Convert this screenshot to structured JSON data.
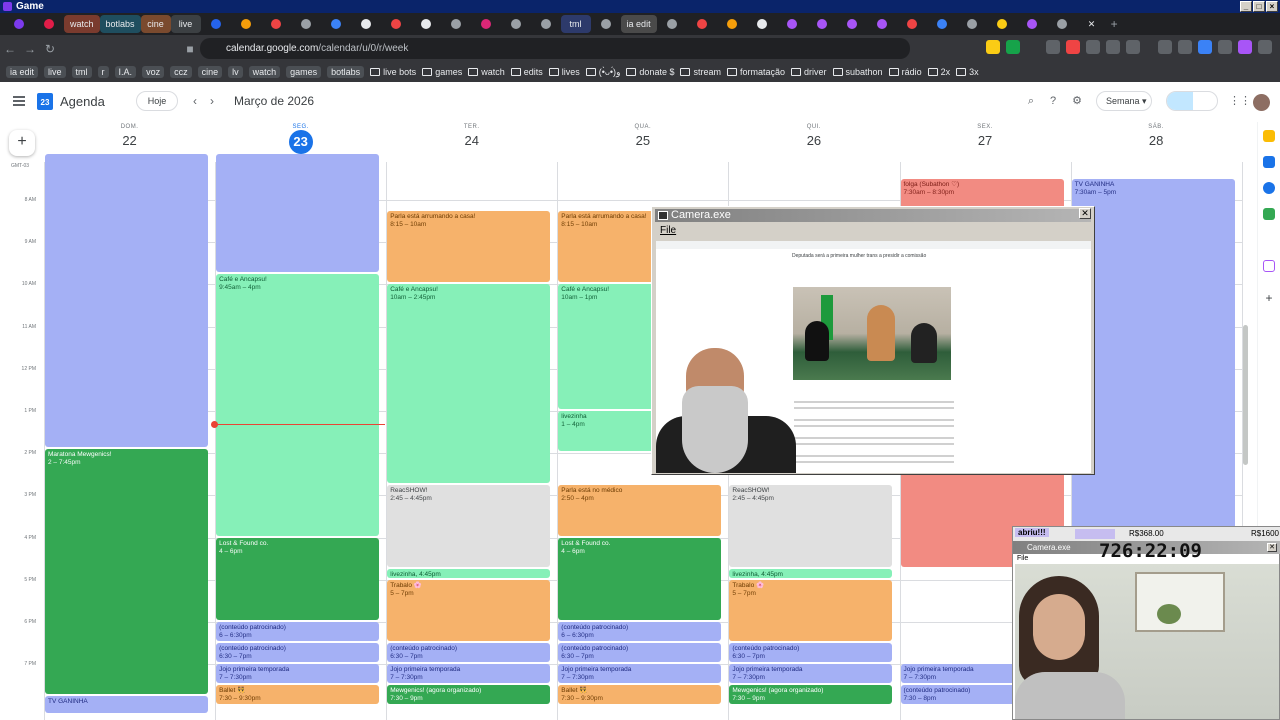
{
  "os": {
    "title": "Game"
  },
  "tabs": [
    {
      "kind": "icon",
      "color": "#7c3aed"
    },
    {
      "kind": "icon",
      "color": "#e11d48"
    },
    {
      "kind": "text",
      "label": "watch",
      "color": "#7a3b2e"
    },
    {
      "kind": "text",
      "label": "botlabs",
      "color": "#1f4e5f"
    },
    {
      "kind": "text",
      "label": "cine",
      "color": "#7a4a2e"
    },
    {
      "kind": "text",
      "label": "live",
      "color": "#3c4043"
    },
    {
      "kind": "icon",
      "color": "#2563eb"
    },
    {
      "kind": "icon",
      "color": "#f59e0b"
    },
    {
      "kind": "icon",
      "color": "#ef4444"
    },
    {
      "kind": "icon",
      "color": "#9aa0a6"
    },
    {
      "kind": "icon",
      "color": "#3b82f6"
    },
    {
      "kind": "icon",
      "color": "#e8eaed"
    },
    {
      "kind": "icon",
      "color": "#ef4444"
    },
    {
      "kind": "icon",
      "color": "#e8eaed"
    },
    {
      "kind": "icon",
      "color": "#9aa0a6"
    },
    {
      "kind": "icon",
      "color": "#db2777"
    },
    {
      "kind": "icon",
      "color": "#9aa0a6"
    },
    {
      "kind": "icon",
      "color": "#9aa0a6"
    },
    {
      "kind": "text",
      "label": "tml",
      "color": "#2d3a6b"
    },
    {
      "kind": "icon",
      "color": "#9aa0a6"
    },
    {
      "kind": "text",
      "label": "ia edit",
      "color": "#4a4a4a"
    },
    {
      "kind": "icon",
      "color": "#9aa0a6"
    },
    {
      "kind": "icon",
      "color": "#ef4444"
    },
    {
      "kind": "icon",
      "color": "#f59e0b"
    },
    {
      "kind": "icon",
      "color": "#e8eaed"
    },
    {
      "kind": "icon",
      "color": "#a855f7"
    },
    {
      "kind": "icon",
      "color": "#a855f7"
    },
    {
      "kind": "icon",
      "color": "#a855f7"
    },
    {
      "kind": "icon",
      "color": "#a855f7"
    },
    {
      "kind": "icon",
      "color": "#ef4444"
    },
    {
      "kind": "icon",
      "color": "#3b82f6"
    },
    {
      "kind": "icon",
      "color": "#9aa0a6"
    },
    {
      "kind": "icon",
      "color": "#facc15"
    },
    {
      "kind": "icon",
      "color": "#a855f7"
    },
    {
      "kind": "icon",
      "color": "#9aa0a6"
    },
    {
      "kind": "close",
      "label": "✕"
    }
  ],
  "address": {
    "host": "calendar.google.com",
    "path": "/calendar/u/0/r/week"
  },
  "bookmarks": [
    {
      "type": "chip",
      "label": "ia edit"
    },
    {
      "type": "chip",
      "label": "live"
    },
    {
      "type": "chip",
      "label": "tml"
    },
    {
      "type": "chip",
      "label": "r"
    },
    {
      "type": "chip",
      "label": "I.A."
    },
    {
      "type": "chip",
      "label": "voz"
    },
    {
      "type": "chip",
      "label": "ccz"
    },
    {
      "type": "chip",
      "label": "cine"
    },
    {
      "type": "chip",
      "label": "lv"
    },
    {
      "type": "chip",
      "label": "watch"
    },
    {
      "type": "chip",
      "label": "games"
    },
    {
      "type": "chip",
      "label": "botlabs"
    },
    {
      "type": "folder",
      "label": "live bots"
    },
    {
      "type": "folder",
      "label": "games"
    },
    {
      "type": "folder",
      "label": "watch"
    },
    {
      "type": "folder",
      "label": "edits"
    },
    {
      "type": "folder",
      "label": "lives"
    },
    {
      "type": "folder",
      "label": "(•̀ᴗ•́)و"
    },
    {
      "type": "folder",
      "label": "donate $"
    },
    {
      "type": "folder",
      "label": "stream"
    },
    {
      "type": "folder",
      "label": "formatação"
    },
    {
      "type": "folder",
      "label": "driver"
    },
    {
      "type": "folder",
      "label": "subathon"
    },
    {
      "type": "folder",
      "label": "rádio"
    },
    {
      "type": "folder",
      "label": "2x"
    },
    {
      "type": "folder",
      "label": "3x"
    }
  ],
  "calendar": {
    "app_name": "Agenda",
    "logo_day": "23",
    "today_label": "Hoje",
    "month": "Março de 2026",
    "view_label": "Semana",
    "timezone": "GMT-03",
    "days": [
      {
        "name": "DOM.",
        "num": "22",
        "today": false
      },
      {
        "name": "SEG.",
        "num": "23",
        "today": true
      },
      {
        "name": "TER.",
        "num": "24",
        "today": false
      },
      {
        "name": "QUA.",
        "num": "25",
        "today": false
      },
      {
        "name": "QUI.",
        "num": "26",
        "today": false
      },
      {
        "name": "SEX.",
        "num": "27",
        "today": false
      },
      {
        "name": "SÁB.",
        "num": "28",
        "today": false
      }
    ],
    "hours": [
      "8 AM",
      "9 AM",
      "10 AM",
      "11 AM",
      "12 PM",
      "1 PM",
      "2 PM",
      "3 PM",
      "4 PM",
      "5 PM",
      "6 PM",
      "7 PM"
    ],
    "events": [
      {
        "day": 0,
        "start": 6.9,
        "end": 13.9,
        "title": "",
        "time": "",
        "color": "blue"
      },
      {
        "day": 0,
        "start": 13.9,
        "end": 19.75,
        "title": "Maratona Mewgenics!",
        "time": "2 – 7:45pm",
        "color": "green"
      },
      {
        "day": 0,
        "start": 19.75,
        "end": 20.2,
        "title": "TV GANINHA",
        "time": "",
        "color": "blue"
      },
      {
        "day": 1,
        "start": 6.9,
        "end": 9.75,
        "title": "",
        "time": "",
        "color": "blue"
      },
      {
        "day": 1,
        "start": 9.75,
        "end": 16.0,
        "title": "Café e Ancapsu!",
        "time": "9:45am – 4pm",
        "color": "mint"
      },
      {
        "day": 1,
        "start": 16.0,
        "end": 18.0,
        "title": "Lost & Found co.",
        "time": "4 – 6pm",
        "color": "green"
      },
      {
        "day": 1,
        "start": 18.0,
        "end": 18.5,
        "title": "(conteúdo patrocinado)",
        "time": "6 – 6:30pm",
        "color": "blue"
      },
      {
        "day": 1,
        "start": 18.5,
        "end": 19.0,
        "title": "(conteúdo patrocinado)",
        "time": "6:30 – 7pm",
        "color": "blue"
      },
      {
        "day": 1,
        "start": 19.0,
        "end": 19.5,
        "title": "Jojo primeira temporada",
        "time": "7 – 7:30pm",
        "color": "blue"
      },
      {
        "day": 1,
        "start": 19.5,
        "end": 20.0,
        "title": "Ballet 👯",
        "time": "7:30 – 9:30pm",
        "color": "orange"
      },
      {
        "day": 2,
        "start": 8.25,
        "end": 10.0,
        "title": "Parla está arrumando a casa!",
        "time": "8:15 – 10am",
        "color": "orange"
      },
      {
        "day": 2,
        "start": 10.0,
        "end": 14.75,
        "title": "Café e Ancapsu!",
        "time": "10am – 2:45pm",
        "color": "mint"
      },
      {
        "day": 2,
        "start": 14.75,
        "end": 16.75,
        "title": "ReacSHOW!",
        "time": "2:45 – 4:45pm",
        "color": "grey"
      },
      {
        "day": 2,
        "start": 16.75,
        "end": 17.0,
        "title": "livezinha, 4:45pm",
        "time": "",
        "color": "mint"
      },
      {
        "day": 2,
        "start": 17.0,
        "end": 18.5,
        "title": "Trabalo 🌸",
        "time": "5 – 7pm",
        "color": "orange"
      },
      {
        "day": 2,
        "start": 18.5,
        "end": 19.0,
        "title": "(conteúdo patrocinado)",
        "time": "6:30 – 7pm",
        "color": "blue"
      },
      {
        "day": 2,
        "start": 19.0,
        "end": 19.5,
        "title": "Jojo primeira temporada",
        "time": "7 – 7:30pm",
        "color": "blue"
      },
      {
        "day": 2,
        "start": 19.5,
        "end": 20.0,
        "title": "Mewgenics! (agora organizado)",
        "time": "7:30 – 9pm",
        "color": "green"
      },
      {
        "day": 3,
        "start": 8.25,
        "end": 10.0,
        "title": "Parla está arrumando a casa!",
        "time": "8:15 – 10am",
        "color": "orange"
      },
      {
        "day": 3,
        "start": 10.0,
        "end": 13.0,
        "title": "Café e Ancapsu!",
        "time": "10am – 1pm",
        "color": "mint"
      },
      {
        "day": 3,
        "start": 13.0,
        "end": 14.0,
        "title": "livezinha",
        "time": "1 – 4pm",
        "color": "mint"
      },
      {
        "day": 3,
        "start": 14.75,
        "end": 16.0,
        "title": "Parla está no médico",
        "time": "2:50 – 4pm",
        "color": "orange"
      },
      {
        "day": 3,
        "start": 16.0,
        "end": 18.0,
        "title": "Lost & Found co.",
        "time": "4 – 6pm",
        "color": "green"
      },
      {
        "day": 3,
        "start": 18.0,
        "end": 18.5,
        "title": "(conteúdo patrocinado)",
        "time": "6 – 6:30pm",
        "color": "blue"
      },
      {
        "day": 3,
        "start": 18.5,
        "end": 19.0,
        "title": "(conteúdo patrocinado)",
        "time": "6:30 – 7pm",
        "color": "blue"
      },
      {
        "day": 3,
        "start": 19.0,
        "end": 19.5,
        "title": "Jojo primeira temporada",
        "time": "7 – 7:30pm",
        "color": "blue"
      },
      {
        "day": 3,
        "start": 19.5,
        "end": 20.0,
        "title": "Ballet 👯",
        "time": "7:30 – 9:30pm",
        "color": "orange"
      },
      {
        "day": 4,
        "start": 14.75,
        "end": 16.75,
        "title": "ReacSHOW!",
        "time": "2:45 – 4:45pm",
        "color": "grey"
      },
      {
        "day": 4,
        "start": 16.75,
        "end": 17.0,
        "title": "livezinha, 4:45pm",
        "time": "",
        "color": "mint"
      },
      {
        "day": 4,
        "start": 17.0,
        "end": 18.5,
        "title": "Trabalo 🌸",
        "time": "5 – 7pm",
        "color": "orange"
      },
      {
        "day": 4,
        "start": 18.5,
        "end": 19.0,
        "title": "(conteúdo patrocinado)",
        "time": "6:30 – 7pm",
        "color": "blue"
      },
      {
        "day": 4,
        "start": 19.0,
        "end": 19.5,
        "title": "Jojo primeira temporada",
        "time": "7 – 7:30pm",
        "color": "blue"
      },
      {
        "day": 4,
        "start": 19.5,
        "end": 20.0,
        "title": "Mewgenics! (agora organizado)",
        "time": "7:30 – 9pm",
        "color": "green"
      },
      {
        "day": 5,
        "start": 7.5,
        "end": 16.75,
        "title": "folga (Subathon ♡)",
        "time": "7:30am – 8:30pm",
        "color": "red"
      },
      {
        "day": 5,
        "start": 19.0,
        "end": 19.5,
        "title": "Jojo primeira temporada",
        "time": "7 – 7:30pm",
        "color": "blue"
      },
      {
        "day": 5,
        "start": 19.5,
        "end": 20.0,
        "title": "(conteúdo patrocinado)",
        "time": "7:30 – 8pm",
        "color": "blue"
      },
      {
        "day": 6,
        "start": 7.5,
        "end": 16.5,
        "title": "TV GANINHA",
        "time": "7:30am – 5pm",
        "color": "blue"
      }
    ]
  },
  "camera_window": {
    "title": "Camera.exe",
    "menu": "File",
    "article_title": "Deputada será a primeira mulher trans a presidir a comissão"
  },
  "stream_overlay": {
    "label": "abriu!!!",
    "value_left": "R$368.00",
    "value_right": "R$1600",
    "title": "Camera.exe",
    "timer": "726:22:09",
    "menu": "File"
  }
}
